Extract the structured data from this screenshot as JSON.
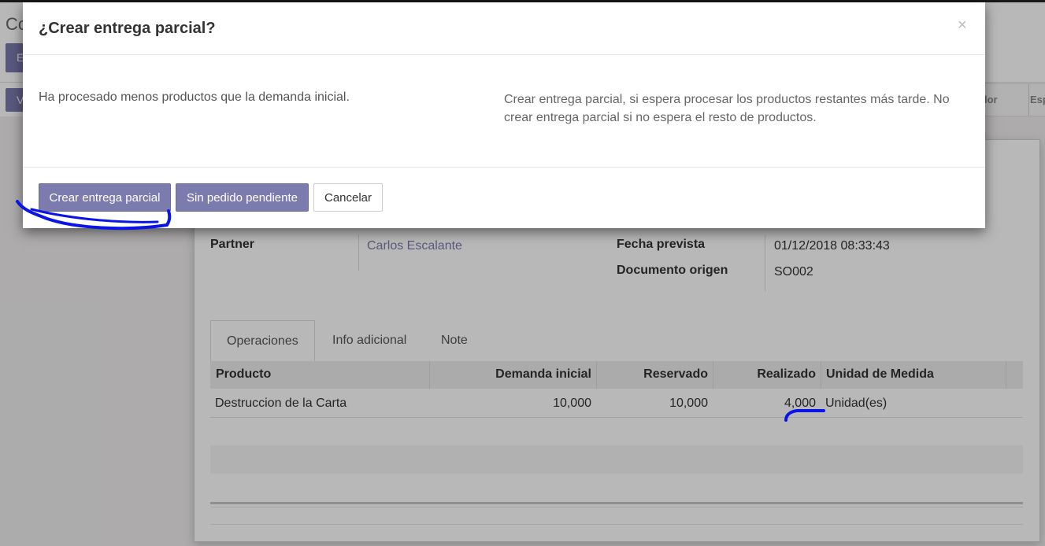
{
  "background": {
    "title_partial": "Co",
    "button_partial": "E",
    "button2_partial": "V",
    "statusbar": {
      "item1_partial": "lor",
      "item2_partial": "Esp"
    },
    "form": {
      "partner_label": "Partner",
      "partner_value": "Carlos Escalante",
      "scheduled_label": "Fecha prevista",
      "scheduled_value": "01/12/2018 08:33:43",
      "origin_label": "Documento origen",
      "origin_value": "SO002"
    },
    "tabs": [
      "Operaciones",
      "Info adicional",
      "Note"
    ],
    "table": {
      "headers": [
        "Producto",
        "Demanda inicial",
        "Reservado",
        "Realizado",
        "Unidad de Medida"
      ],
      "rows": [
        [
          "Destruccion de la Carta",
          "10,000",
          "10,000",
          "4,000",
          "Unidad(es)"
        ]
      ]
    }
  },
  "modal": {
    "title": "¿Crear entrega parcial?",
    "close_icon": "×",
    "message_left": "Ha procesado menos productos que la demanda inicial.",
    "message_right": "Crear entrega parcial, si espera procesar los productos restantes más tarde. No crear entrega parcial si no espera el resto de productos.",
    "buttons": {
      "create_backorder": "Crear entrega parcial",
      "no_backorder": "Sin pedido pendiente",
      "cancel": "Cancelar"
    }
  },
  "colors": {
    "primary": "#7c7bad",
    "annotation": "#0a14e6"
  }
}
